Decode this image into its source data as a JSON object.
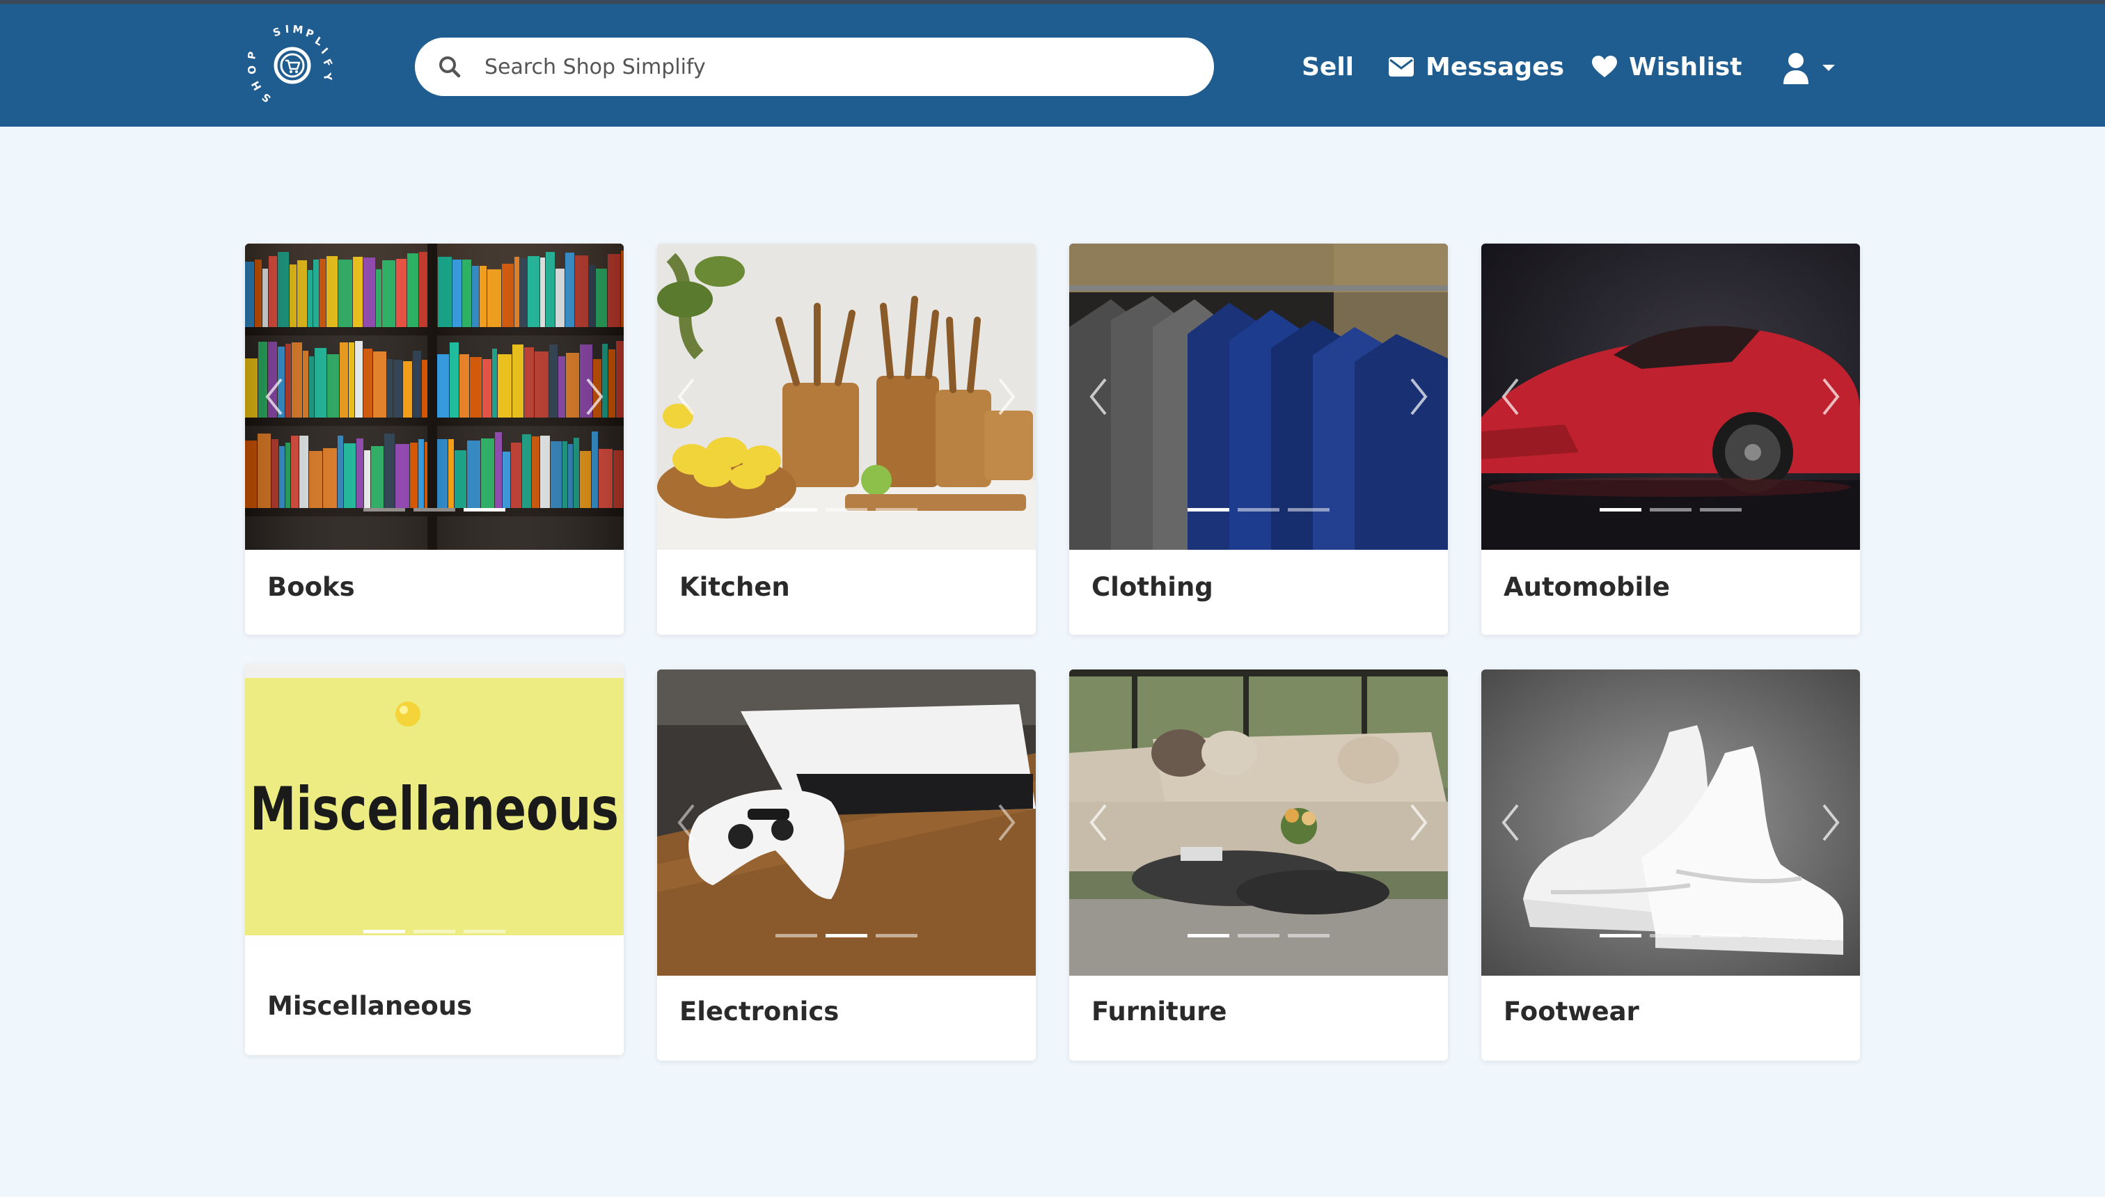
{
  "header": {
    "logo_text": "SHOP SIMPLIFY",
    "search_placeholder": "Search Shop Simplify",
    "nav": {
      "sell": "Sell",
      "messages": "Messages",
      "wishlist": "Wishlist"
    },
    "icons": {
      "search": "search-icon",
      "messages": "envelope-icon",
      "wishlist": "heart-icon",
      "user": "user-icon",
      "dropdown": "caret-down-icon"
    }
  },
  "colors": {
    "navbar": "#1f5d91",
    "page_background": "#eff6fc",
    "card_background": "#ffffff"
  },
  "categories": [
    {
      "title": "Books",
      "active_slide": 3,
      "slides": 3
    },
    {
      "title": "Kitchen",
      "active_slide": 1,
      "slides": 3
    },
    {
      "title": "Clothing",
      "active_slide": 1,
      "slides": 3
    },
    {
      "title": "Automobile",
      "active_slide": 1,
      "slides": 3
    },
    {
      "title": "Miscellaneous",
      "active_slide": 1,
      "slides": 3
    },
    {
      "title": "Electronics",
      "active_slide": 2,
      "slides": 3
    },
    {
      "title": "Furniture",
      "active_slide": 1,
      "slides": 3
    },
    {
      "title": "Footwear",
      "active_slide": 1,
      "slides": 3
    }
  ]
}
